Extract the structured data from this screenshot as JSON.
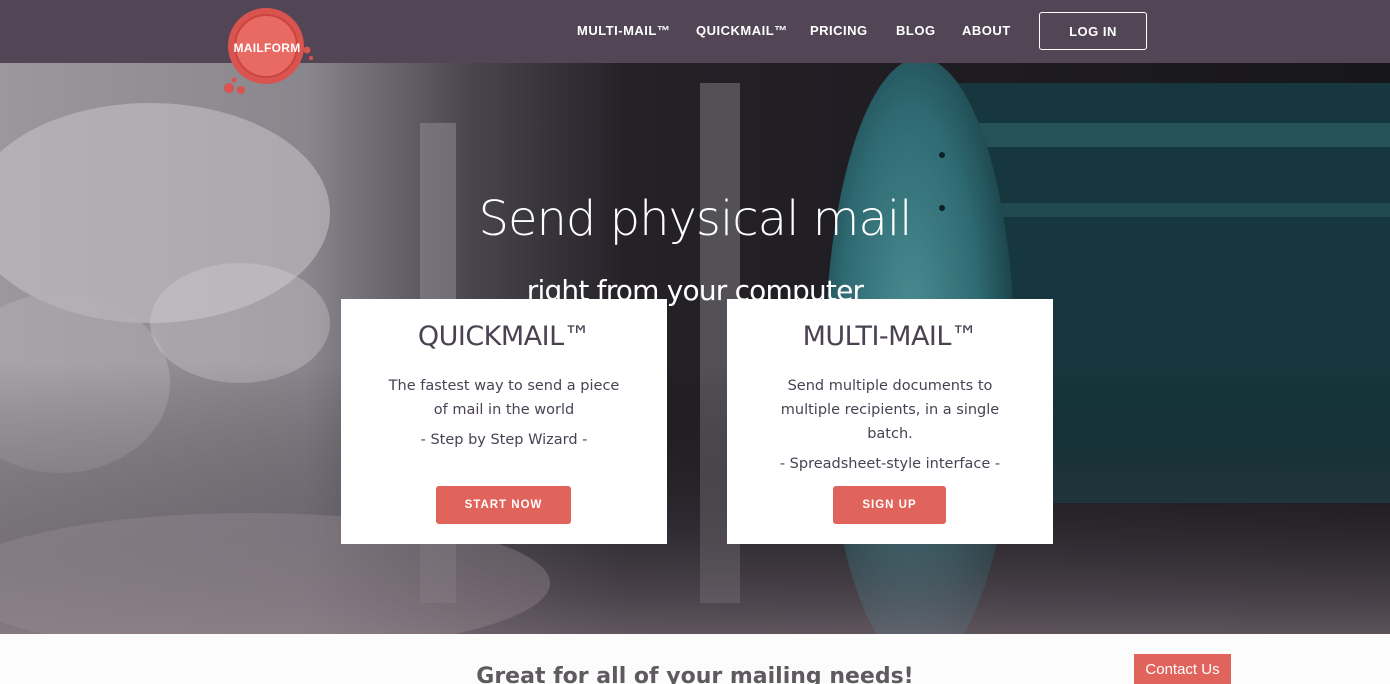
{
  "brand": {
    "logo_text": "MAILFORM",
    "accent": "#e0635c",
    "nav_bg": "#524656"
  },
  "nav": {
    "items": [
      "MULTI-MAIL™",
      "QUICKMAIL™",
      "PRICING",
      "BLOG",
      "ABOUT"
    ],
    "login_label": "LOG IN"
  },
  "hero": {
    "title": "Send physical mail",
    "subtitle": "right from your computer"
  },
  "cards": [
    {
      "title": "QUICKMAIL™",
      "description": "The fastest way to send a piece of mail in the world",
      "feature": "- Step by Step Wizard -",
      "button": "START NOW"
    },
    {
      "title": "MULTI-MAIL™",
      "description": "Send multiple documents to multiple recipients, in a single batch.",
      "feature": "- Spreadsheet-style interface -",
      "button": "SIGN UP"
    }
  ],
  "section": {
    "heading": "Great for all of your mailing needs!"
  },
  "contact": {
    "label": "Contact Us"
  }
}
